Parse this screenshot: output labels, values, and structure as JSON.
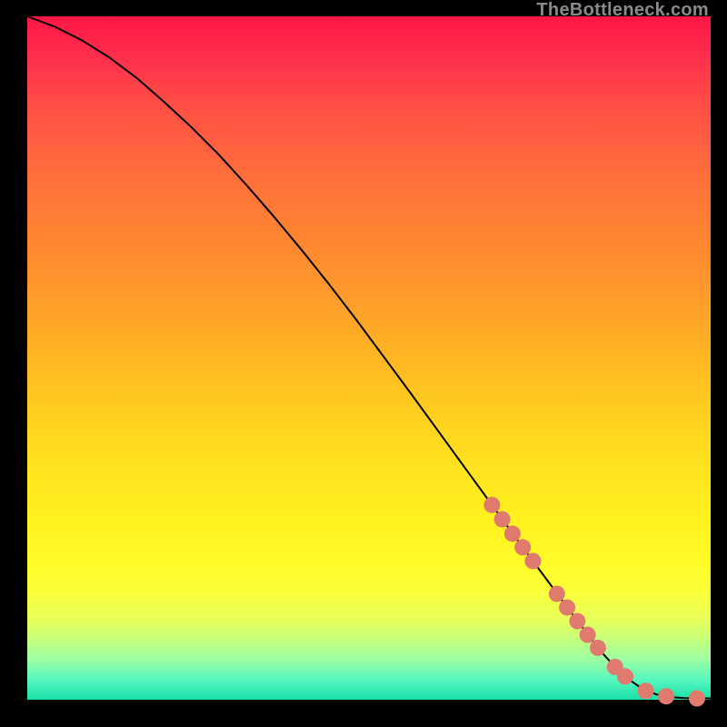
{
  "watermark": "TheBottleneck.com",
  "colors": {
    "marker": "#e07a6e",
    "line": "#000000"
  },
  "chart_data": {
    "type": "line",
    "title": "",
    "xlabel": "",
    "ylabel": "",
    "xlim": [
      0,
      100
    ],
    "ylim": [
      0,
      100
    ],
    "grid": false,
    "legend": false,
    "series": [
      {
        "name": "curve",
        "x": [
          0,
          4,
          8,
          12,
          16,
          20,
          24,
          28,
          32,
          36,
          40,
          44,
          48,
          52,
          56,
          60,
          64,
          68,
          72,
          76,
          80,
          84,
          86,
          88,
          90,
          92,
          94,
          96,
          98,
          100
        ],
        "y": [
          100,
          98.5,
          96.5,
          94,
          91,
          87.5,
          83.8,
          79.8,
          75.4,
          70.8,
          66,
          61,
          55.8,
          50.4,
          45,
          39.5,
          34,
          28.5,
          23,
          17.6,
          12.2,
          7.0,
          4.8,
          3.0,
          1.6,
          0.8,
          0.4,
          0.25,
          0.2,
          0.2
        ]
      }
    ],
    "markers": [
      {
        "x": 68,
        "y": 28.5
      },
      {
        "x": 69.5,
        "y": 26.4
      },
      {
        "x": 71,
        "y": 24.3
      },
      {
        "x": 72.5,
        "y": 22.3
      },
      {
        "x": 74,
        "y": 20.3
      },
      {
        "x": 77.5,
        "y": 15.5
      },
      {
        "x": 79,
        "y": 13.5
      },
      {
        "x": 80.5,
        "y": 11.5
      },
      {
        "x": 82,
        "y": 9.5
      },
      {
        "x": 83.5,
        "y": 7.6
      },
      {
        "x": 86,
        "y": 4.8
      },
      {
        "x": 87.5,
        "y": 3.4
      },
      {
        "x": 90.5,
        "y": 1.3
      },
      {
        "x": 93.5,
        "y": 0.5
      },
      {
        "x": 98,
        "y": 0.2
      }
    ]
  }
}
